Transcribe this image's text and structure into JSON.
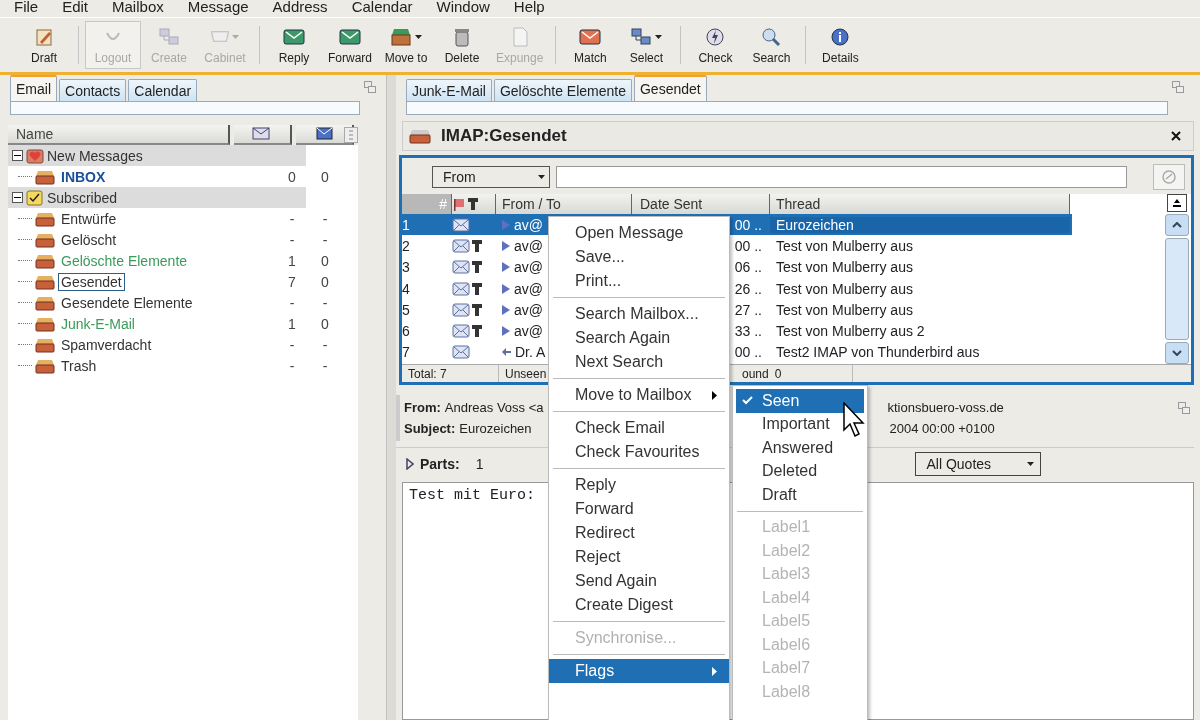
{
  "menu_bar": [
    "File",
    "Edit",
    "Mailbox",
    "Message",
    "Address",
    "Calendar",
    "Window",
    "Help"
  ],
  "toolbar": [
    {
      "label": "Draft",
      "disabled": false,
      "dropdown": false
    },
    {
      "label": "Logout",
      "disabled": true,
      "dropdown": false
    },
    {
      "label": "Create",
      "disabled": true,
      "dropdown": false
    },
    {
      "label": "Cabinet",
      "disabled": true,
      "dropdown": true
    },
    {
      "label": "Reply",
      "disabled": false,
      "dropdown": false
    },
    {
      "label": "Forward",
      "disabled": false,
      "dropdown": false
    },
    {
      "label": "Move to",
      "disabled": false,
      "dropdown": true
    },
    {
      "label": "Delete",
      "disabled": false,
      "dropdown": false
    },
    {
      "label": "Expunge",
      "disabled": true,
      "dropdown": false
    },
    {
      "label": "Match",
      "disabled": false,
      "dropdown": false
    },
    {
      "label": "Select",
      "disabled": false,
      "dropdown": true
    },
    {
      "label": "Check",
      "disabled": false,
      "dropdown": false
    },
    {
      "label": "Search",
      "disabled": false,
      "dropdown": false
    },
    {
      "label": "Details",
      "disabled": false,
      "dropdown": false
    }
  ],
  "left_panel": {
    "tabs": [
      {
        "label": "Email",
        "selected": true
      },
      {
        "label": "Contacts",
        "selected": false
      },
      {
        "label": "Calendar",
        "selected": false
      }
    ],
    "tree_header": "Name",
    "tree": [
      {
        "label": "New Messages",
        "expanded": true,
        "children": [
          {
            "label": "INBOX",
            "kind": "inbox",
            "selected": false,
            "counts": [
              "0",
              "0"
            ]
          }
        ]
      },
      {
        "label": "Subscribed",
        "expanded": true,
        "children": [
          {
            "label": "Entwürfe",
            "kind": "plain",
            "selected": false,
            "counts": [
              "-",
              "-"
            ]
          },
          {
            "label": "Gelöscht",
            "kind": "plain",
            "selected": false,
            "counts": [
              "-",
              "-"
            ]
          },
          {
            "label": "Gelöschte Elemente",
            "kind": "unseen",
            "selected": false,
            "counts": [
              "1",
              "0"
            ]
          },
          {
            "label": "Gesendet",
            "kind": "plain",
            "selected": true,
            "counts": [
              "7",
              "0"
            ]
          },
          {
            "label": "Gesendete Elemente",
            "kind": "plain",
            "selected": false,
            "counts": [
              "-",
              "-"
            ]
          },
          {
            "label": "Junk-E-Mail",
            "kind": "unseen",
            "selected": false,
            "counts": [
              "1",
              "0"
            ]
          },
          {
            "label": "Spamverdacht",
            "kind": "plain",
            "selected": false,
            "counts": [
              "-",
              "-"
            ]
          },
          {
            "label": "Trash",
            "kind": "plain",
            "selected": false,
            "counts": [
              "-",
              "-"
            ]
          }
        ]
      }
    ]
  },
  "right_panel": {
    "tabs": [
      {
        "label": "Junk-E-Mail",
        "selected": false
      },
      {
        "label": "Gelöschte Elemente",
        "selected": false
      },
      {
        "label": "Gesendet",
        "selected": true
      }
    ],
    "mailbox_title": "IMAP:Gesendet",
    "search_field": "From",
    "message_list": {
      "columns": [
        "#",
        "From / To",
        "Date Sent",
        "Thread"
      ],
      "rows": [
        {
          "number": "1",
          "from": "av@",
          "date": "00 ..",
          "thread": "Eurozeichen",
          "selected": true,
          "marked": false,
          "kind": "sent"
        },
        {
          "number": "2",
          "from": "av@",
          "date": "00 ..",
          "thread": "Test von Mulberry aus",
          "selected": false,
          "marked": true,
          "kind": "sent"
        },
        {
          "number": "3",
          "from": "av@",
          "date": "06 ..",
          "thread": "Test von Mulberry aus",
          "selected": false,
          "marked": true,
          "kind": "sent"
        },
        {
          "number": "4",
          "from": "av@",
          "date": "26 ..",
          "thread": "Test von Mulberry aus",
          "selected": false,
          "marked": true,
          "kind": "sent"
        },
        {
          "number": "5",
          "from": "av@",
          "date": "27 ..",
          "thread": "Test von Mulberry aus",
          "selected": false,
          "marked": true,
          "kind": "sent"
        },
        {
          "number": "6",
          "from": "av@",
          "date": "33 ..",
          "thread": "Test von Mulberry aus 2",
          "selected": false,
          "marked": true,
          "kind": "sent"
        },
        {
          "number": "7",
          "from": "Dr. A",
          "date": "00 ..",
          "thread": "Test2 IMAP von Thunderbird aus",
          "selected": false,
          "marked": false,
          "kind": "received"
        }
      ]
    },
    "status_bar": [
      "Total: 7",
      "Unseen",
      "ound",
      "0"
    ],
    "preview": {
      "from_label": "From:",
      "from": "Andreas Voss <a",
      "from_tail": "ktionsbuero-voss.de",
      "subject_label": "Subject:",
      "subject": "Eurozeichen",
      "date_tail": "2004 00:00 +0100",
      "parts_label": "Parts:",
      "parts": "1",
      "quotes": "All Quotes",
      "body": "Test mit Euro:"
    }
  },
  "context_menu": [
    [
      {
        "label": "Open Message",
        "disabled": false,
        "submenu": false,
        "selected": false
      },
      {
        "label": "Save...",
        "disabled": false,
        "submenu": false,
        "selected": false
      },
      {
        "label": "Print...",
        "disabled": false,
        "submenu": false,
        "selected": false
      }
    ],
    [
      {
        "label": "Search Mailbox...",
        "disabled": false,
        "submenu": false,
        "selected": false
      },
      {
        "label": "Search Again",
        "disabled": false,
        "submenu": false,
        "selected": false
      },
      {
        "label": "Next Search",
        "disabled": false,
        "submenu": false,
        "selected": false
      }
    ],
    [
      {
        "label": "Move to Mailbox",
        "disabled": false,
        "submenu": true,
        "selected": false
      }
    ],
    [
      {
        "label": "Check Email",
        "disabled": false,
        "submenu": false,
        "selected": false
      },
      {
        "label": "Check Favourites",
        "disabled": false,
        "submenu": false,
        "selected": false
      }
    ],
    [
      {
        "label": "Reply",
        "disabled": false,
        "submenu": false,
        "selected": false
      },
      {
        "label": "Forward",
        "disabled": false,
        "submenu": false,
        "selected": false
      },
      {
        "label": "Redirect",
        "disabled": false,
        "submenu": false,
        "selected": false
      },
      {
        "label": "Reject",
        "disabled": false,
        "submenu": false,
        "selected": false
      },
      {
        "label": "Send Again",
        "disabled": false,
        "submenu": false,
        "selected": false
      },
      {
        "label": "Create Digest",
        "disabled": false,
        "submenu": false,
        "selected": false
      }
    ],
    [
      {
        "label": "Synchronise...",
        "disabled": true,
        "submenu": false,
        "selected": false
      }
    ],
    [
      {
        "label": "Flags",
        "disabled": false,
        "submenu": true,
        "selected": true
      }
    ]
  ],
  "flags_submenu": [
    [
      {
        "label": "Seen",
        "checked": true,
        "selected": true,
        "disabled": false
      },
      {
        "label": "Important",
        "checked": false,
        "selected": false,
        "disabled": false
      },
      {
        "label": "Answered",
        "checked": false,
        "selected": false,
        "disabled": false
      },
      {
        "label": "Deleted",
        "checked": false,
        "selected": false,
        "disabled": false
      },
      {
        "label": "Draft",
        "checked": false,
        "selected": false,
        "disabled": false
      }
    ],
    [
      {
        "label": "Label1",
        "checked": false,
        "selected": false,
        "disabled": true
      },
      {
        "label": "Label2",
        "checked": false,
        "selected": false,
        "disabled": true
      },
      {
        "label": "Label3",
        "checked": false,
        "selected": false,
        "disabled": true
      },
      {
        "label": "Label4",
        "checked": false,
        "selected": false,
        "disabled": true
      },
      {
        "label": "Label5",
        "checked": false,
        "selected": false,
        "disabled": true
      },
      {
        "label": "Label6",
        "checked": false,
        "selected": false,
        "disabled": true
      },
      {
        "label": "Label7",
        "checked": false,
        "selected": false,
        "disabled": true
      },
      {
        "label": "Label8",
        "checked": false,
        "selected": false,
        "disabled": true
      }
    ]
  ]
}
